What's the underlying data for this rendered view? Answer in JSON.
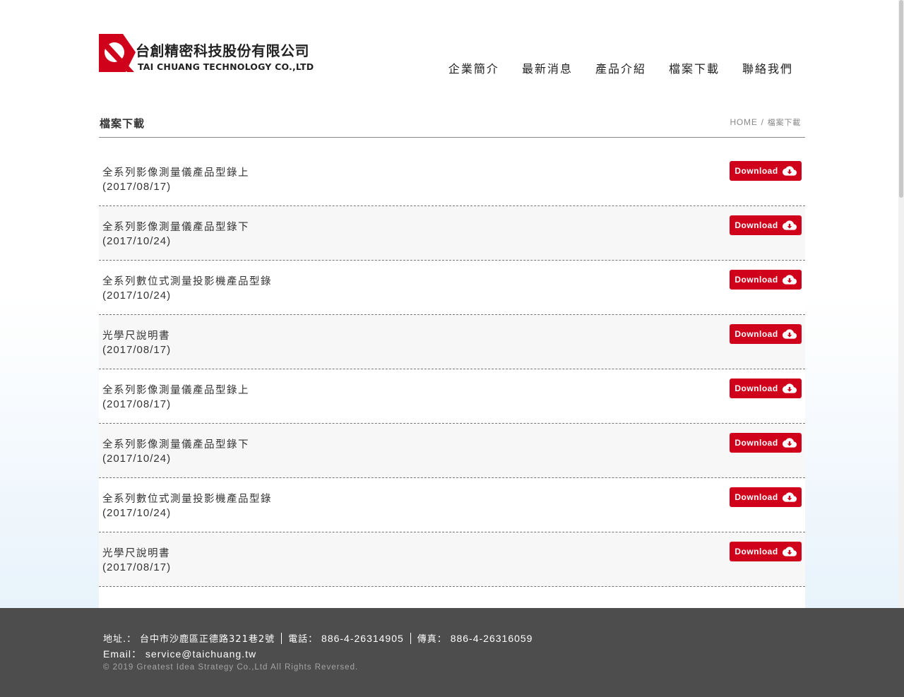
{
  "brand": {
    "name_cn": "台創精密科技股份有限公司",
    "name_en": "TAI CHUANG TECHNOLOGY CO.,LTD",
    "logo_color": "#d0021b"
  },
  "nav": [
    {
      "label": "企業簡介"
    },
    {
      "label": "最新消息"
    },
    {
      "label": "產品介紹"
    },
    {
      "label": "檔案下載"
    },
    {
      "label": "聯絡我們"
    }
  ],
  "page": {
    "title": "檔案下載",
    "breadcrumb": {
      "home": "HOME",
      "separator": "/",
      "current": "檔案下載"
    }
  },
  "download_label": "Download",
  "download_icon": "cloud-download-icon",
  "accent_color": "#d0021b",
  "files": [
    {
      "title": "全系列影像測量儀產品型錄上",
      "date": "(2017/08/17)"
    },
    {
      "title": "全系列影像測量儀產品型錄下",
      "date": "(2017/10/24)"
    },
    {
      "title": "全系列數位式測量投影機產品型錄",
      "date": "(2017/10/24)"
    },
    {
      "title": "光學尺說明書",
      "date": "(2017/08/17)"
    },
    {
      "title": "全系列影像測量儀產品型錄上",
      "date": "(2017/08/17)"
    },
    {
      "title": "全系列影像測量儀產品型錄下",
      "date": "(2017/10/24)"
    },
    {
      "title": "全系列數位式測量投影機產品型錄",
      "date": "(2017/10/24)"
    },
    {
      "title": "光學尺說明書",
      "date": "(2017/08/17)"
    }
  ],
  "footer": {
    "address_label": "地址.：",
    "address": "台中市沙鹿區正德路321巷2號",
    "phone_label": "電話：",
    "phone": "886-4-26314905",
    "fax_label": "傳真：",
    "fax": "886-4-26316059",
    "email_label": "Email：",
    "email": "service@taichuang.tw",
    "copyright": "© 2019 Greatest Idea Strategy Co.,Ltd All Rights Reversed."
  }
}
